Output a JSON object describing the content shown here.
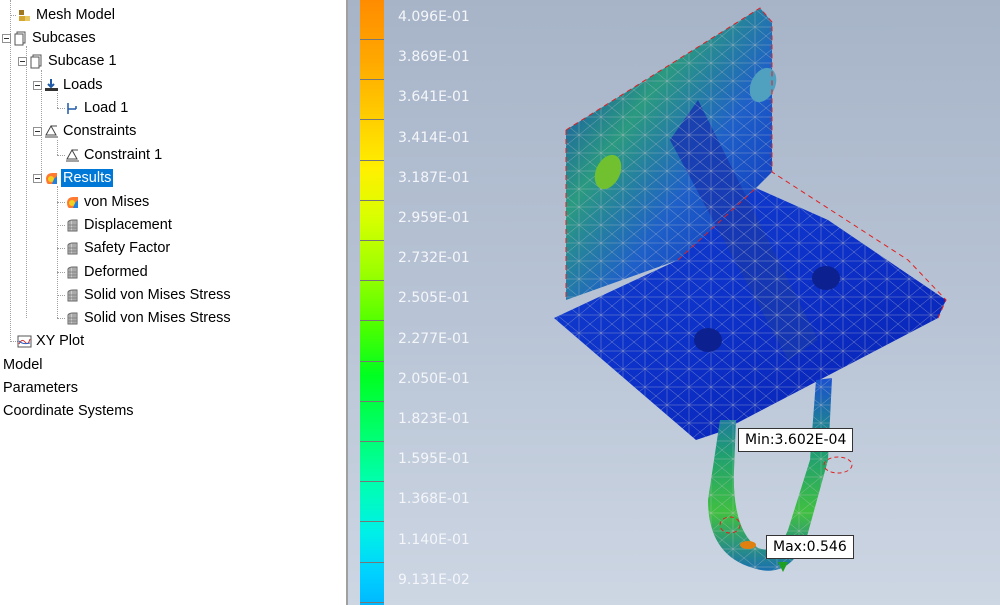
{
  "tree": {
    "items": [
      {
        "label": "Mesh Model",
        "icon": "mesh-icon"
      },
      {
        "label": "Subcases",
        "icon": "document-icon"
      },
      {
        "label": "Subcase 1",
        "icon": "document-icon"
      },
      {
        "label": "Loads",
        "icon": "loads-icon"
      },
      {
        "label": "Load 1",
        "icon": "load-icon"
      },
      {
        "label": "Constraints",
        "icon": "constraint-icon"
      },
      {
        "label": "Constraint 1",
        "icon": "constraint-icon"
      },
      {
        "label": "Results",
        "icon": "results-icon",
        "selected": true
      },
      {
        "label": "von Mises",
        "icon": "results-icon"
      },
      {
        "label": "Displacement",
        "icon": "mesh-grid-icon"
      },
      {
        "label": "Safety Factor",
        "icon": "mesh-grid-icon"
      },
      {
        "label": "Deformed",
        "icon": "mesh-grid-icon"
      },
      {
        "label": "Solid von Mises Stress",
        "icon": "mesh-grid-icon"
      },
      {
        "label": "Solid von Mises Stress",
        "icon": "mesh-grid-icon"
      },
      {
        "label": "XY Plot",
        "icon": "xy-plot-icon"
      }
    ],
    "root_items": [
      "Model",
      "Parameters",
      "Coordinate Systems"
    ]
  },
  "legend": {
    "values": [
      "4.096E-01",
      "3.869E-01",
      "3.641E-01",
      "3.414E-01",
      "3.187E-01",
      "2.959E-01",
      "2.732E-01",
      "2.505E-01",
      "2.277E-01",
      "2.050E-01",
      "1.823E-01",
      "1.595E-01",
      "1.368E-01",
      "1.140E-01",
      "9.131E-02"
    ]
  },
  "callouts": {
    "min": "Min:3.602E-04",
    "max": "Max:0.546"
  },
  "colors": {
    "selection": "#0078d7",
    "mesh_low": "#0a2ccc",
    "mesh_mid": "#22b060",
    "constraint_lines": "#e02020"
  }
}
